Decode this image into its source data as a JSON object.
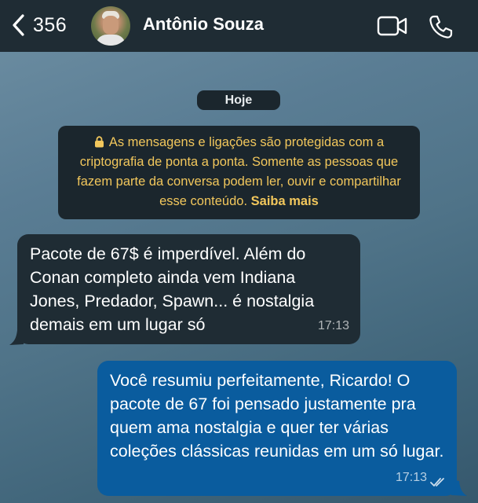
{
  "header": {
    "back_count": "356",
    "contact_name": "Antônio Souza",
    "icons": [
      "chevron-left-icon",
      "video-icon",
      "phone-icon"
    ],
    "background_color": "#1f2c34"
  },
  "chat": {
    "date_label": "Hoje",
    "encryption_notice": {
      "text": "As mensagens e ligações são protegidas com a criptografia de ponta a ponta. Somente as pessoas que fazem parte da conversa podem ler, ouvir e compartilhar esse conteúdo.",
      "link": "Saiba mais",
      "color": "#f2c75c"
    },
    "messages": [
      {
        "direction": "incoming",
        "text": "Pacote de 67$ é imperdível. Além do Conan completo ainda vem Indiana Jones, Predador, Spawn... é nostalgia demais em um lugar só",
        "time": "17:13",
        "bubble_color": "#1f2c34"
      },
      {
        "direction": "outgoing",
        "text": "Você resumiu perfeitamente, Ricardo! O pacote de 67 foi pensado justamente pra quem ama nostalgia e quer ter várias coleções clássicas reunidas em um só lugar.",
        "time": "17:13",
        "status_icon": "double-check-icon",
        "bubble_color": "#0a5c9e"
      }
    ]
  }
}
